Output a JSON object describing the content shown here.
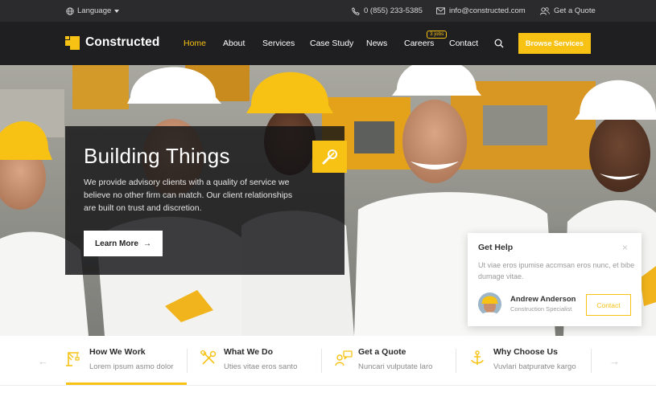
{
  "topbar": {
    "language_label": "Language",
    "phone": "0 (855) 233-5385",
    "email": "info@constructed.com",
    "quote_label": "Get a Quote"
  },
  "nav": {
    "brand": "Constructed",
    "items": [
      {
        "label": "Home",
        "active": true
      },
      {
        "label": "About",
        "active": false
      },
      {
        "label": "Services",
        "active": false
      },
      {
        "label": "Case Study",
        "active": false
      },
      {
        "label": "News",
        "active": false
      },
      {
        "label": "Careers",
        "active": false
      },
      {
        "label": "Contact",
        "active": false
      }
    ],
    "careers_badge": "3 jobs",
    "cta_label": "Browse Services"
  },
  "hero": {
    "title": "Building Things",
    "description": "We provide advisory clients with a quality of service we believe no other firm can match. Our client relationships are built on trust and discretion.",
    "button_label": "Learn More",
    "button_arrow": "→"
  },
  "help_card": {
    "title": "Get Help",
    "close_symbol": "×",
    "text": "Ut viae eros ipumise accmsan eros nunc, et bibe dumage vitae.",
    "name": "Andrew Anderson",
    "role": "Construction Specialist",
    "contact_label": "Contact"
  },
  "features": {
    "prev_symbol": "←",
    "next_symbol": "→",
    "items": [
      {
        "title": "How We Work",
        "desc": "Lorem ipsum asmo dolor",
        "icon": "crane-icon",
        "active": true
      },
      {
        "title": "What We Do",
        "desc": "Uties vitae eros santo",
        "icon": "tools-icon",
        "active": false
      },
      {
        "title": "Get a Quote",
        "desc": "Nuncari vulputate laro",
        "icon": "quote-chat-icon",
        "active": false
      },
      {
        "title": "Why Choose Us",
        "desc": "Vuvlari batpuratve kargo",
        "icon": "anchor-icon",
        "active": false
      }
    ]
  },
  "colors": {
    "accent": "#f7c213",
    "topbar_bg": "#2b2b2d",
    "nav_bg": "#1f1f21"
  }
}
